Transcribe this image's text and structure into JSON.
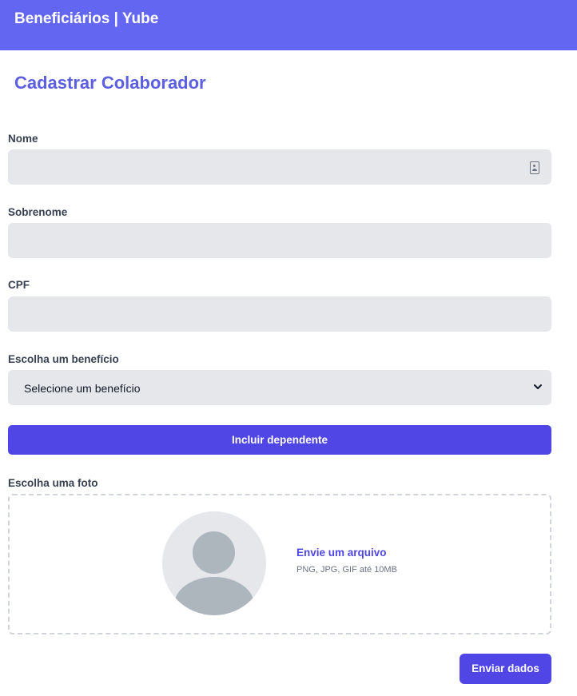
{
  "header": {
    "title": "Beneficiários | Yube"
  },
  "page": {
    "title": "Cadastrar Colaborador"
  },
  "form": {
    "nome": {
      "label": "Nome",
      "value": ""
    },
    "sobrenome": {
      "label": "Sobrenome",
      "value": ""
    },
    "cpf": {
      "label": "CPF",
      "value": ""
    },
    "beneficio": {
      "label": "Escolha um benefício",
      "selected": "Selecione um benefício"
    },
    "include_dependent_label": "Incluir dependente",
    "foto": {
      "label": "Escolha uma foto",
      "upload_link": "Envie um arquivo",
      "hint": "PNG, JPG, GIF até 10MB"
    },
    "submit_label": "Enviar dados"
  },
  "colors": {
    "header_bg": "#6366f1",
    "primary": "#4f46e5",
    "title": "#5b5fe0",
    "field_bg": "#e5e7eb"
  },
  "icons": {
    "nome_field": "contact-card-icon",
    "select": "chevron-down-icon",
    "avatar": "user-silhouette-icon"
  }
}
